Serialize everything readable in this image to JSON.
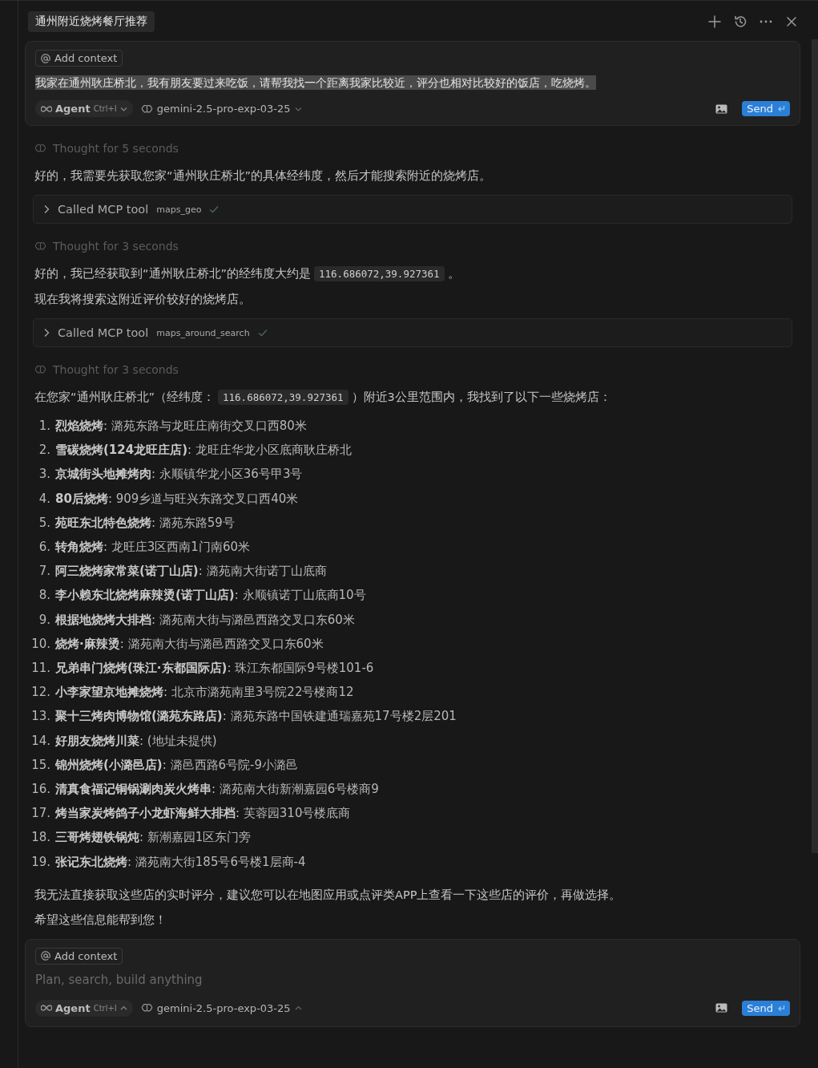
{
  "header": {
    "title": "通州附近烧烤餐厅推荐"
  },
  "prompt": {
    "context_label": "Add context",
    "text": "我家在通州耿庄桥北，我有朋友要过来吃饭，请帮我找一个距离我家比较近，评分也相对比较好的饭店，吃烧烤。",
    "selected": true,
    "mode": "Agent",
    "shortcut": "Ctrl+I",
    "model": "gemini-2.5-pro-exp-03-25",
    "send": "Send"
  },
  "messages": [
    {
      "kind": "thought",
      "text": "Thought for 5 seconds"
    },
    {
      "kind": "para",
      "parts": [
        {
          "text": "好的，我需要先获取您家“通州耿庄桥北”的具体经纬度，然后才能搜索附近的烧烤店。"
        }
      ]
    },
    {
      "kind": "tool",
      "label": "Called MCP tool",
      "tool": "maps_geo"
    },
    {
      "kind": "thought",
      "text": "Thought for 3 seconds"
    },
    {
      "kind": "para",
      "parts": [
        {
          "text": "好的，我已经获取到“通州耿庄桥北”的经纬度大约是"
        },
        {
          "text": "116.686072,39.927361",
          "code": true
        },
        {
          "text": "。"
        }
      ]
    },
    {
      "kind": "para",
      "parts": [
        {
          "text": "现在我将搜索这附近评价较好的烧烤店。"
        }
      ]
    },
    {
      "kind": "tool",
      "label": "Called MCP tool",
      "tool": "maps_around_search"
    },
    {
      "kind": "thought",
      "text": "Thought for 3 seconds"
    },
    {
      "kind": "para",
      "parts": [
        {
          "text": "在您家“通州耿庄桥北”（经纬度："
        },
        {
          "text": "116.686072,39.927361",
          "code": true
        },
        {
          "text": "）附近3公里范围内，我找到了以下一些烧烤店："
        }
      ]
    },
    {
      "kind": "list",
      "items": [
        {
          "number": "1.",
          "text": "**烈焰烧烤**: 潞苑东路与龙旺庄南街交叉口西80米"
        },
        {
          "number": "2.",
          "text": "**雪碳烧烤(124龙旺庄店)**: 龙旺庄华龙小区底商耿庄桥北"
        },
        {
          "number": "3.",
          "text": "**京城街头地摊烤肉**: 永顺镇华龙小区36号甲3号"
        },
        {
          "number": "4.",
          "text": "**80后烧烤**: 909乡道与旺兴东路交叉口西40米"
        },
        {
          "number": "5.",
          "text": "**苑旺东北特色烧烤**: 潞苑东路59号"
        },
        {
          "number": "6.",
          "text": "**转角烧烤**: 龙旺庄3区西南1门南60米"
        },
        {
          "number": "7.",
          "text": "**阿三烧烤家常菜(诺丁山店)**: 潞苑南大街诺丁山底商"
        },
        {
          "number": "8.",
          "text": "**李小赖东北烧烤麻辣烫(诺丁山店)**: 永顺镇诺丁山底商10号"
        },
        {
          "number": "9.",
          "text": "**根据地烧烤大排档**: 潞苑南大街与潞邑西路交叉口东60米"
        },
        {
          "number": "10.",
          "text": "**烧烤·麻辣烫**: 潞苑南大街与潞邑西路交叉口东60米"
        },
        {
          "number": "11.",
          "text": "**兄弟串门烧烤(珠江·东都国际店)**: 珠江东都国际9号楼101-6"
        },
        {
          "number": "12.",
          "text": "**小李家望京地摊烧烤**: 北京市潞苑南里3号院22号楼商12"
        },
        {
          "number": "13.",
          "text": "**聚十三烤肉博物馆(潞苑东路店)**: 潞苑东路中国铁建通瑞嘉苑17号楼2层201"
        },
        {
          "number": "14.",
          "text": "**好朋友烧烤川菜**: (地址未提供)"
        },
        {
          "number": "15.",
          "text": "**锦州烧烤(小潞邑店)**: 潞邑西路6号院-9小潞邑"
        },
        {
          "number": "16.",
          "text": "**清真食福记铜锅涮肉炭火烤串**: 潞苑南大街新潮嘉园6号楼商9"
        },
        {
          "number": "17.",
          "text": "**烤当家炭烤鸽子小龙虾海鲜大排档**: 芙蓉园310号楼底商"
        },
        {
          "number": "18.",
          "text": "**三哥烤翅铁锅炖**: 新潮嘉园1区东门旁"
        },
        {
          "number": "19.",
          "text": "**张记东北烧烤**: 潞苑南大街185号6号楼1层商-4"
        }
      ]
    },
    {
      "kind": "para",
      "parts": [
        {
          "text": "我无法直接获取这些店的实时评分，建议您可以在地图应用或点评类APP上查看一下这些店的评价，再做选择。"
        }
      ]
    },
    {
      "kind": "para",
      "parts": [
        {
          "text": "希望这些信息能帮到您！"
        }
      ]
    }
  ],
  "composer": {
    "context_label": "Add context",
    "placeholder": "Plan, search, build anything",
    "mode": "Agent",
    "shortcut": "Ctrl+I",
    "model": "gemini-2.5-pro-exp-03-25",
    "send": "Send"
  }
}
